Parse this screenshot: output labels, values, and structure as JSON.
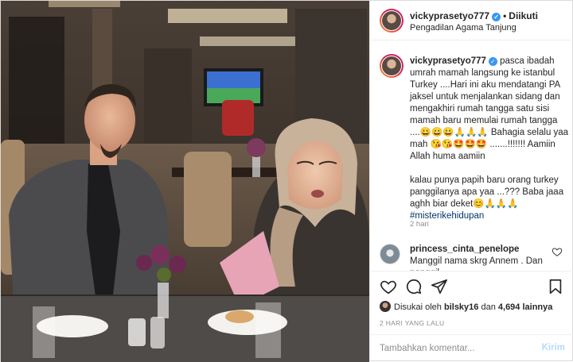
{
  "header": {
    "username": "vickyprasetyo777",
    "follow_status": "Diikuti",
    "location": "Pengadilan Agama Tanjung"
  },
  "caption": {
    "username": "vickyprasetyo777",
    "lines": [
      "pasca ibadah umrah mamah langsung ke istanbul Turkey ....Hari ini aku mendatangi PA jaksel untuk menjalankan sidang dan mengakhiri rumah tangga satu sisi mamah baru memulai rumah tangga ....😀😀😀🙏🙏🙏 Bahagia selalu yaa mah 😘😘🤩🤩🤩 .......!!!!!!! Aamiin Allah huma aamiin",
      "kalau punya papih baru orang turkey panggilanya apa yaa ...??? Baba jaaa aghh biar deket😊🙏🙏🙏"
    ],
    "hashtag": "#misterikehidupan",
    "time": "2 hari"
  },
  "comment": {
    "username": "princess_cinta_penelope",
    "text": "Manggil nama skrg Annem . Dan panggil"
  },
  "likes": {
    "prefix": "Disukai oleh",
    "user": "bilsky16",
    "connector": "dan",
    "count": "4,694 lainnya"
  },
  "date": "2 HARI YANG LALU",
  "add_comment": {
    "placeholder": "Tambahkan komentar...",
    "post_label": "Kirim"
  },
  "icons": [
    "heart-icon",
    "comment-icon",
    "share-icon",
    "bookmark-icon",
    "verified-badge-icon"
  ],
  "colors": {
    "link": "#003569",
    "verified": "#3897f0",
    "post_disabled": "#b3dbff",
    "muted": "#8e8e8e"
  }
}
